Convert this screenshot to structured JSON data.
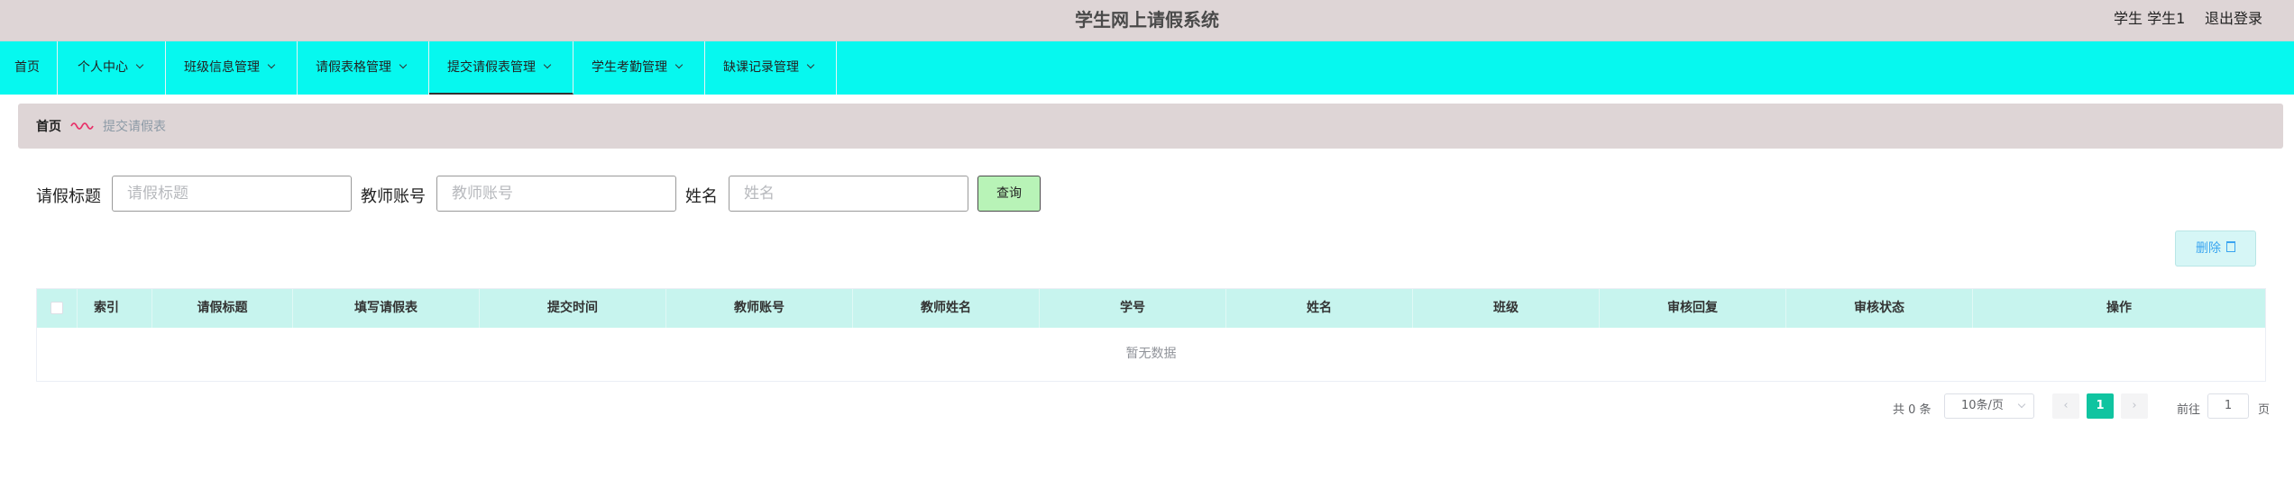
{
  "header": {
    "title": "学生网上请假系统",
    "user": "学生 学生1",
    "logout": "退出登录"
  },
  "nav": {
    "items": [
      {
        "label": "首页",
        "dropdown": false
      },
      {
        "label": "个人中心",
        "dropdown": true
      },
      {
        "label": "班级信息管理",
        "dropdown": true
      },
      {
        "label": "请假表格管理",
        "dropdown": true
      },
      {
        "label": "提交请假表管理",
        "dropdown": true,
        "active": true
      },
      {
        "label": "学生考勤管理",
        "dropdown": true
      },
      {
        "label": "缺课记录管理",
        "dropdown": true
      }
    ]
  },
  "breadcrumb": {
    "home": "首页",
    "current": "提交请假表"
  },
  "search": {
    "fields": [
      {
        "label": "请假标题",
        "placeholder": "请假标题"
      },
      {
        "label": "教师账号",
        "placeholder": "教师账号"
      },
      {
        "label": "姓名",
        "placeholder": "姓名"
      }
    ],
    "button": "查询"
  },
  "actions": {
    "delete": "删除"
  },
  "table": {
    "columns": [
      "索引",
      "请假标题",
      "填写请假表",
      "提交时间",
      "教师账号",
      "教师姓名",
      "学号",
      "姓名",
      "班级",
      "审核回复",
      "审核状态",
      "操作"
    ],
    "empty_text": "暂无数据"
  },
  "pagination": {
    "total": "共 0 条",
    "page_size": "10条/页",
    "current_page": "1",
    "goto_label": "前往",
    "goto_value": "1",
    "goto_unit": "页"
  },
  "colors": {
    "header_bg": "#ded5d6",
    "nav_bg": "#06f8ef",
    "table_header_bg": "#c7f4ee",
    "search_button_bg": "#b8f3b7",
    "pager_active": "#10c4a0",
    "breadcrumb_separator": "#e8336a"
  }
}
